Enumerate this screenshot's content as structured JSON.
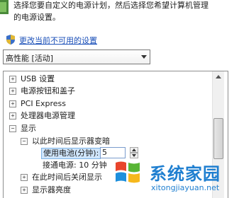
{
  "intro": {
    "line1": "选择您要自定义的电源计划，然后选择您希望计算机管理",
    "line2": "的电源设置。"
  },
  "change_link": "更改当前不可用的设置",
  "plan_select": {
    "value": "高性能 [活动]"
  },
  "tree": {
    "items": [
      {
        "label": "USB 设置",
        "expander": "+"
      },
      {
        "label": "电源按钮和盖子",
        "expander": "+"
      },
      {
        "label": "PCI Express",
        "expander": "+"
      },
      {
        "label": "处理器电源管理",
        "expander": "+"
      },
      {
        "label": "显示",
        "expander": "−"
      },
      {
        "label": "以此时间后显示器变暗",
        "expander": "−"
      },
      {
        "label": "使用电池(分钟):",
        "value": "5"
      },
      {
        "label": "接通电源: 10 分钟"
      },
      {
        "label": "在此时间后关闭显示",
        "expander": "+"
      },
      {
        "label": "显示器亮度",
        "expander": "+"
      }
    ]
  },
  "watermark": {
    "title": "系统家园",
    "url": "xitongjiayuan.net"
  },
  "colors": {
    "link": "#1a4fb8",
    "accent": "#1f7fd0",
    "selection": "#cfe5fb"
  }
}
